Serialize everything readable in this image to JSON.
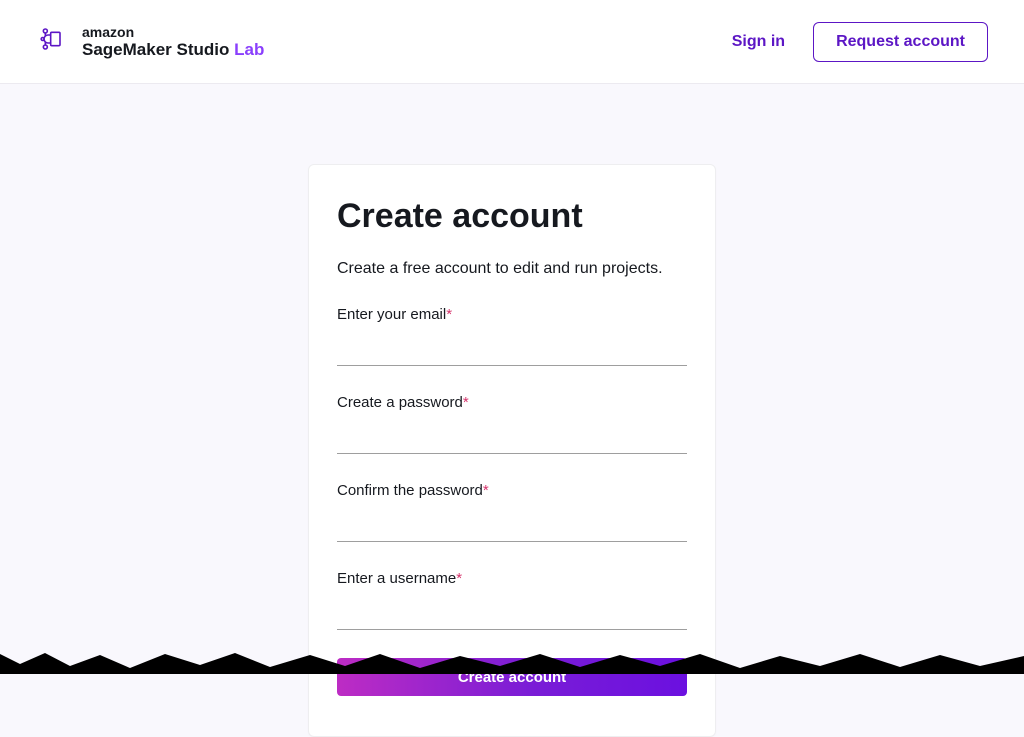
{
  "header": {
    "brand_top": "amazon",
    "brand_main": "SageMaker Studio",
    "brand_lab": "Lab",
    "signin": "Sign in",
    "request": "Request account"
  },
  "form": {
    "title": "Create account",
    "subtitle": "Create a free account to edit and run projects.",
    "fields": {
      "email": {
        "label": "Enter your email",
        "required": "*",
        "value": ""
      },
      "password": {
        "label": "Create a password",
        "required": "*",
        "value": ""
      },
      "confirm": {
        "label": "Confirm the password",
        "required": "*",
        "value": ""
      },
      "username": {
        "label": "Enter a username",
        "required": "*",
        "value": ""
      }
    },
    "submit": "Create account"
  }
}
